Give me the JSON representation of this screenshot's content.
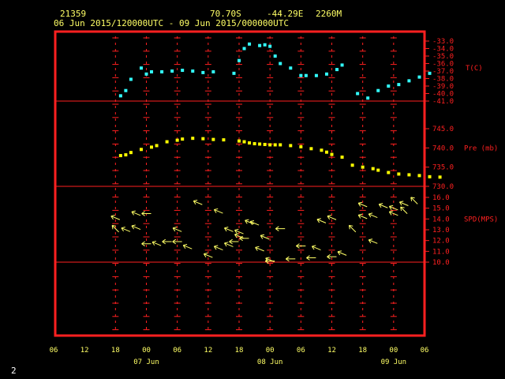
{
  "header": {
    "station_id": "21359",
    "lat": "70.70S",
    "lon": "-44.29E",
    "elevation": "2260M",
    "range": "06 Jun 2015/120000UTC - 09 Jun 2015/000000UTC"
  },
  "page_number": "2",
  "colors": {
    "frame": "#ff2020",
    "text": "#ffff66",
    "temp": "#33ffff",
    "pres": "#ffff00",
    "wind": "#ffff66"
  },
  "chart_data": {
    "type": "scatter",
    "x_ticks": [
      "06",
      "12",
      "18",
      "00",
      "06",
      "12",
      "18",
      "00",
      "06",
      "12",
      "18",
      "00",
      "06"
    ],
    "date_labels": [
      "07 Jun",
      "08 Jun",
      "09 Jun"
    ],
    "panels": [
      {
        "name": "temperature",
        "label": "T(C)",
        "ylim": [
          -41,
          -33
        ],
        "ticks": [
          "-33.0",
          "-34.0",
          "-35.0",
          "-36.0",
          "-37.0",
          "-38.0",
          "-39.0",
          "-40.0",
          "-41.0"
        ],
        "x_hours": [
          13,
          14,
          15,
          17,
          18,
          19,
          21,
          23,
          25,
          27,
          29,
          31,
          35,
          36,
          37,
          38,
          40,
          41,
          42,
          43,
          44,
          46,
          48,
          49,
          51,
          53,
          55,
          56,
          59,
          61,
          63,
          65,
          67,
          69,
          71,
          73
        ],
        "values": [
          -40.3,
          -39.6,
          -38.1,
          -36.6,
          -37.4,
          -37.1,
          -37.1,
          -37.0,
          -36.9,
          -37.0,
          -37.2,
          -37.1,
          -37.3,
          -35.6,
          -34.0,
          -33.4,
          -33.6,
          -33.5,
          -33.7,
          -35.0,
          -36.0,
          -36.6,
          -37.6,
          -37.6,
          -37.6,
          -37.4,
          -36.8,
          -36.2,
          -40.0,
          -40.6,
          -39.6,
          -39.0,
          -38.8,
          -38.3,
          -37.8,
          -37.3
        ]
      },
      {
        "name": "pressure",
        "label": "Pre (mb)",
        "ylim": [
          730,
          750
        ],
        "ticks": [
          "745.0",
          "740.0",
          "735.0",
          "730.0"
        ],
        "x_hours": [
          13,
          14,
          15,
          17,
          19,
          20,
          22,
          24,
          25,
          27,
          29,
          31,
          33,
          36,
          37,
          38,
          39,
          40,
          41,
          42,
          43,
          44,
          46,
          48,
          50,
          52,
          53,
          54,
          56,
          58,
          60,
          62,
          63,
          65,
          67,
          69,
          71,
          73,
          75
        ],
        "values": [
          738.0,
          738.2,
          738.8,
          739.6,
          740.2,
          740.6,
          741.6,
          742.0,
          742.3,
          742.5,
          742.4,
          742.2,
          742.1,
          741.8,
          741.6,
          741.3,
          741.1,
          741.0,
          740.9,
          740.8,
          740.8,
          740.8,
          740.6,
          740.3,
          739.8,
          739.4,
          738.9,
          738.3,
          737.6,
          735.5,
          735.0,
          734.6,
          734.2,
          733.6,
          733.2,
          733.0,
          732.8,
          732.5,
          732.4
        ]
      },
      {
        "name": "wind",
        "label": "SPD(MPS)",
        "ylim": [
          10,
          16
        ],
        "ticks": [
          "16.0",
          "15.0",
          "14.0",
          "13.0",
          "12.0",
          "11.0",
          "10.0"
        ],
        "x_hours": [
          12,
          12,
          14,
          16,
          16,
          18,
          18,
          20,
          22,
          24,
          24,
          26,
          28,
          30,
          32,
          32,
          34,
          34,
          35,
          36,
          36,
          37,
          38,
          39,
          40,
          41,
          42,
          42,
          44,
          46,
          48,
          50,
          51,
          52,
          54,
          54,
          56,
          58,
          60,
          60,
          62,
          62,
          64,
          66,
          66,
          68,
          68,
          70
        ],
        "speeds": [
          13.1,
          14.1,
          13.0,
          13.2,
          14.5,
          11.7,
          14.5,
          11.7,
          11.9,
          11.9,
          13.0,
          11.4,
          15.5,
          10.6,
          14.7,
          11.3,
          11.6,
          13.0,
          11.9,
          12.4,
          12.8,
          12.2,
          13.7,
          13.6,
          11.2,
          12.3,
          10.1,
          10.2,
          13.1,
          10.3,
          11.5,
          10.4,
          11.3,
          13.8,
          10.5,
          14.1,
          10.8,
          13.1,
          15.3,
          14.2,
          14.3,
          11.9,
          15.2,
          15.0,
          14.5,
          15.4,
          14.8,
          15.7
        ],
        "directions": [
          "NW",
          "WNW",
          "WNW",
          "WNW",
          "WNW",
          "W",
          "W",
          "WNW",
          "W",
          "W",
          "WNW",
          "WNW",
          "WNW",
          "WNW",
          "WNW",
          "WNW",
          "WNW",
          "WNW",
          "W",
          "WNW",
          "WNW",
          "W",
          "WNW",
          "WNW",
          "WNW",
          "WNW",
          "W",
          "WNW",
          "W",
          "W",
          "W",
          "W",
          "WNW",
          "WNW",
          "W",
          "WNW",
          "WNW",
          "NW",
          "WNW",
          "WNW",
          "WNW",
          "WNW",
          "WNW",
          "WNW",
          "WNW",
          "WNW",
          "NW",
          "NW"
        ]
      }
    ]
  }
}
